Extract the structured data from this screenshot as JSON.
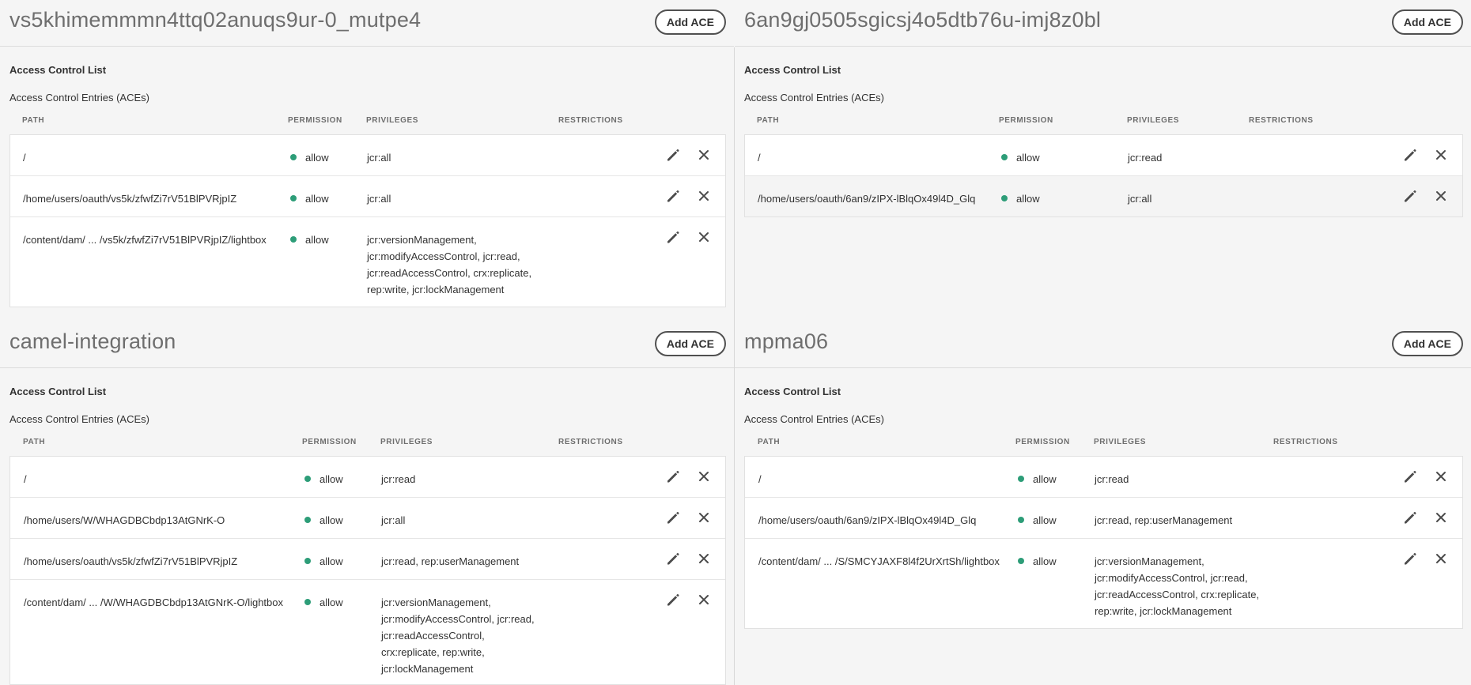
{
  "common": {
    "add_ace": "Add ACE",
    "acl_label": "Access Control List",
    "aces_label": "Access Control Entries (ACEs)",
    "col_path": "PATH",
    "col_permission": "PERMISSION",
    "col_privileges": "PRIVILEGES",
    "col_restrictions": "RESTRICTIONS",
    "allow_color": "#2d9d78"
  },
  "panels": [
    {
      "title": "vs5khimemmmn4ttq02anuqs9ur-0_mutpe4",
      "entries": [
        {
          "path": "/",
          "permission": "allow",
          "privileges": [
            "jcr:all"
          ]
        },
        {
          "path": "/home/users/oauth/vs5k/zfwfZi7rV51BlPVRjpIZ",
          "permission": "allow",
          "privileges": [
            "jcr:all"
          ]
        },
        {
          "path": "/content/dam/ ... /vs5k/zfwfZi7rV51BlPVRjpIZ/lightbox",
          "permission": "allow",
          "privileges": [
            "jcr:versionManagement,",
            "jcr:modifyAccessControl, jcr:read,",
            "jcr:readAccessControl, crx:replicate,",
            "rep:write, jcr:lockManagement"
          ]
        }
      ]
    },
    {
      "title": "6an9gj0505sgicsj4o5dtb76u-imj8z0bl",
      "entries": [
        {
          "path": "/",
          "permission": "allow",
          "privileges": [
            "jcr:read"
          ]
        },
        {
          "path": "/home/users/oauth/6an9/zIPX-lBlqOx49l4D_Glq",
          "permission": "allow",
          "privileges": [
            "jcr:all"
          ]
        }
      ]
    },
    {
      "title": "camel-integration",
      "entries": [
        {
          "path": "/",
          "permission": "allow",
          "privileges": [
            "jcr:read"
          ]
        },
        {
          "path": "/home/users/W/WHAGDBCbdp13AtGNrK-O",
          "permission": "allow",
          "privileges": [
            "jcr:all"
          ]
        },
        {
          "path": "/home/users/oauth/vs5k/zfwfZi7rV51BlPVRjpIZ",
          "permission": "allow",
          "privileges": [
            "jcr:read, rep:userManagement"
          ]
        },
        {
          "path": "/content/dam/ ... /W/WHAGDBCbdp13AtGNrK-O/lightbox",
          "permission": "allow",
          "privileges": [
            "jcr:versionManagement,",
            "jcr:modifyAccessControl, jcr:read,",
            "jcr:readAccessControl,",
            "crx:replicate, rep:write,",
            "jcr:lockManagement"
          ]
        }
      ]
    },
    {
      "title": "mpma06",
      "entries": [
        {
          "path": "/",
          "permission": "allow",
          "privileges": [
            "jcr:read"
          ]
        },
        {
          "path": "/home/users/oauth/6an9/zIPX-lBlqOx49l4D_Glq",
          "permission": "allow",
          "privileges": [
            "jcr:read, rep:userManagement"
          ]
        },
        {
          "path": "/content/dam/ ... /S/SMCYJAXF8l4f2UrXrtSh/lightbox",
          "permission": "allow",
          "privileges": [
            "jcr:versionManagement,",
            "jcr:modifyAccessControl, jcr:read,",
            "jcr:readAccessControl, crx:replicate,",
            "rep:write, jcr:lockManagement"
          ]
        }
      ]
    }
  ]
}
